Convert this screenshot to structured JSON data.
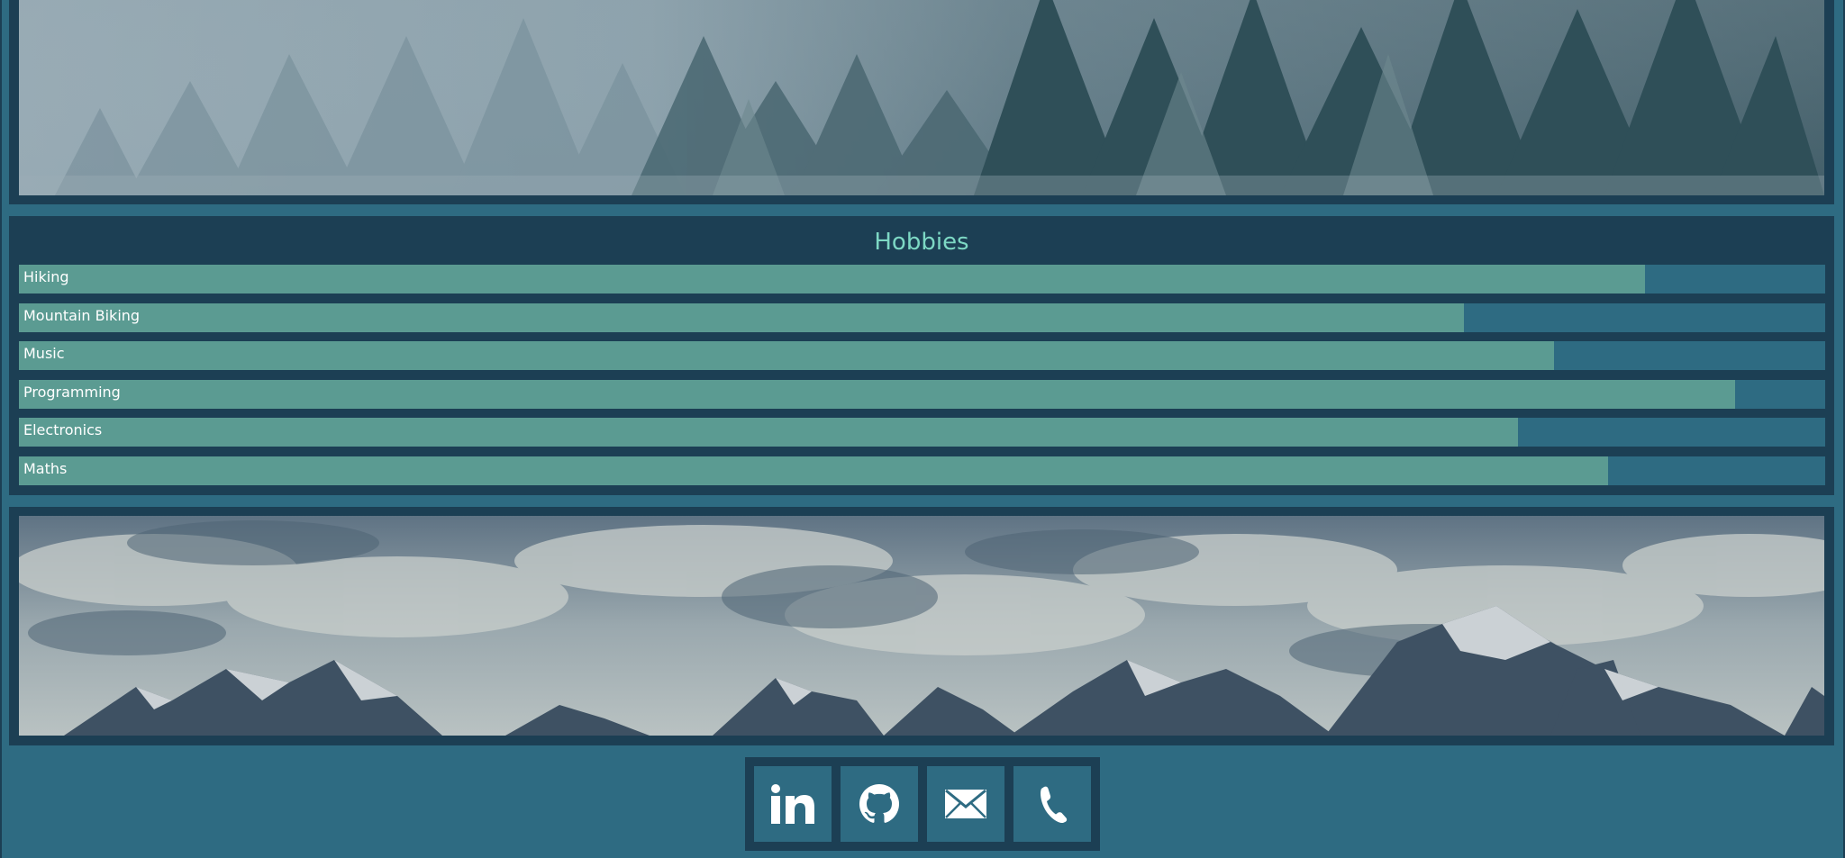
{
  "hobbies": {
    "title": "Hobbies",
    "items": [
      {
        "label": "Hiking",
        "level": 0.9
      },
      {
        "label": "Mountain Biking",
        "level": 0.8
      },
      {
        "label": "Music",
        "level": 0.85
      },
      {
        "label": "Programming",
        "level": 0.95
      },
      {
        "label": "Electronics",
        "level": 0.83
      },
      {
        "label": "Maths",
        "level": 0.88
      }
    ]
  },
  "social": {
    "buttons": [
      {
        "icon": "linkedin-icon"
      },
      {
        "icon": "github-icon"
      },
      {
        "icon": "mail-icon"
      },
      {
        "icon": "phone-icon"
      }
    ]
  },
  "colors": {
    "page_bg": "#2e6b82",
    "panel_bg": "#1c3f54",
    "bar_fill": "#5b9b92",
    "bar_track": "#2e6b82",
    "title_accent": "#7dd8c4"
  }
}
